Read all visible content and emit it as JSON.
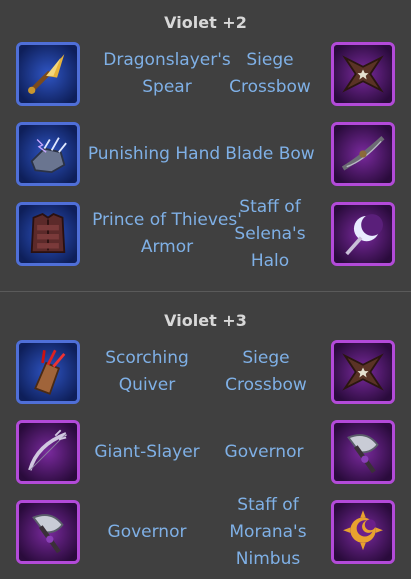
{
  "sections": [
    {
      "title": "Violet +2",
      "rows": [
        {
          "left_item": "Dragonslayer's Spear",
          "right_item": "Siege Crossbow",
          "left_icon": "spear-icon",
          "right_icon": "crossbow-icon",
          "left_tier": "blue",
          "right_tier": "violet"
        },
        {
          "left_item": "Punishing Hand",
          "right_item": "Blade Bow",
          "left_icon": "gauntlet-icon",
          "right_icon": "blade-bow-icon",
          "left_tier": "blue",
          "right_tier": "violet"
        },
        {
          "left_item": "Prince of Thieves' Armor",
          "right_item": "Staff of Selena's Halo",
          "left_icon": "armor-icon",
          "right_icon": "moon-staff-icon",
          "left_tier": "blue",
          "right_tier": "violet"
        }
      ]
    },
    {
      "title": "Violet +3",
      "rows": [
        {
          "left_item": "Scorching Quiver",
          "right_item": "Siege Crossbow",
          "left_icon": "quiver-icon",
          "right_icon": "crossbow-icon",
          "left_tier": "blue",
          "right_tier": "violet"
        },
        {
          "left_item": "Giant-Slayer",
          "right_item": "Governor",
          "left_icon": "bow-icon",
          "right_icon": "axe-icon",
          "left_tier": "violet",
          "right_tier": "violet"
        },
        {
          "left_item": "Governor",
          "right_item": "Staff of Morana's Nimbus",
          "left_icon": "axe-icon",
          "right_icon": "sun-staff-icon",
          "left_tier": "violet",
          "right_tier": "violet"
        }
      ]
    }
  ],
  "colors": {
    "background": "#404040",
    "item_text": "#7fb0e6",
    "title_text": "#d8d8d8",
    "blue_frame": "#4f6fd8",
    "violet_frame": "#b34ad9"
  }
}
